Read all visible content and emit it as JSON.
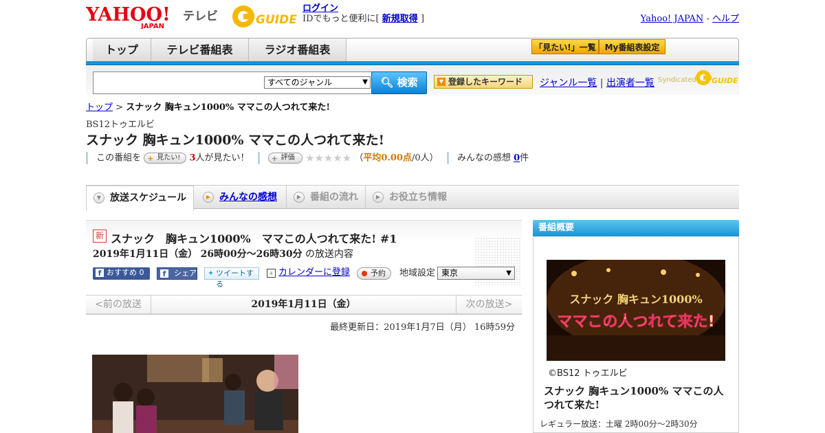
{
  "header": {
    "yahoo_logo_text": "YAHOO!",
    "yahoo_logo_sub": "JAPAN",
    "tv_label": "テレビ",
    "gguide_logo_text": "GUIDE",
    "login_link": "ログイン",
    "login_prompt": "IDでもっと便利に[",
    "register_link": "新規取得",
    "login_suffix": "]",
    "yahoo_japan_link": "Yahoo! JAPAN",
    "link_sep": "-",
    "help_link": "ヘルプ"
  },
  "nav": {
    "tabs": [
      "トップ",
      "テレビ番組表",
      "ラジオ番組表"
    ],
    "want_list_button": "「見たい!」一覧",
    "my_schedule_button": "My番組表設定"
  },
  "search": {
    "input_value": "",
    "genre_selected": "すべてのジャンル",
    "search_button": "検索",
    "keyword_button": "登録したキーワード",
    "genre_list_link": "ジャンル一覧",
    "link_divider": "|",
    "cast_list_link": "出演者一覧",
    "syndicated": "Syndicated"
  },
  "breadcrumb": {
    "top": "トップ",
    "sep": ">",
    "current": "スナック 胸キュン1000% ママこの人つれて来た!"
  },
  "program": {
    "channel": "BS12トゥエルビ",
    "title": "スナック 胸キュン1000% ママこの人つれて来た!",
    "this_program_label": "この番組を",
    "want_button": "見たい!",
    "want_count": "3",
    "want_suffix": "人が見たい！",
    "rate_button": "評価",
    "stars": "★★★★★",
    "avg_prefix": "（",
    "avg_label": "平均0.00点",
    "avg_suffix": "/0人）",
    "review_label": "みんなの感想",
    "review_count": "0",
    "review_suffix": "件"
  },
  "tabs": {
    "schedule": "放送スケジュール",
    "reviews": "みんなの感想",
    "flow": "番組の流れ",
    "info": "お役立ち情報"
  },
  "episode": {
    "new_badge": "新",
    "title": "スナック　胸キュン1000%　ママこの人つれて来た! #1",
    "date": "2019年1月11日（金）",
    "time": "26時00分～26時30分",
    "date_suffix": "の放送内容",
    "fb_recommend": "おすすめ 0",
    "fb_share": "シェア",
    "tweet": "ツイートする",
    "calendar": "カレンダーに登録",
    "reserve": "予約",
    "region_label": "地域設定",
    "region_value": "東京"
  },
  "daynav": {
    "prev": "<前の放送",
    "current": "2019年1月11日（金）",
    "next": "次の放送>"
  },
  "updated": "最終更新日：2019年1月7日（月）  16時59分",
  "sidebar": {
    "header": "番組概要",
    "image_line1": "スナック 胸キュン1000%",
    "image_line2": "ママこの人つれて来た!",
    "copyright": "©BS12 トゥエルビ",
    "title": "スナック 胸キュン1000% ママこの人つれて来た!",
    "regular": "レギュラー放送：土曜 2時00分～2時30分"
  },
  "colors": {
    "link": "#0000cc",
    "nav_blue": "#1694d8",
    "accent_orange": "#f0a400",
    "want_red": "#d40000"
  }
}
